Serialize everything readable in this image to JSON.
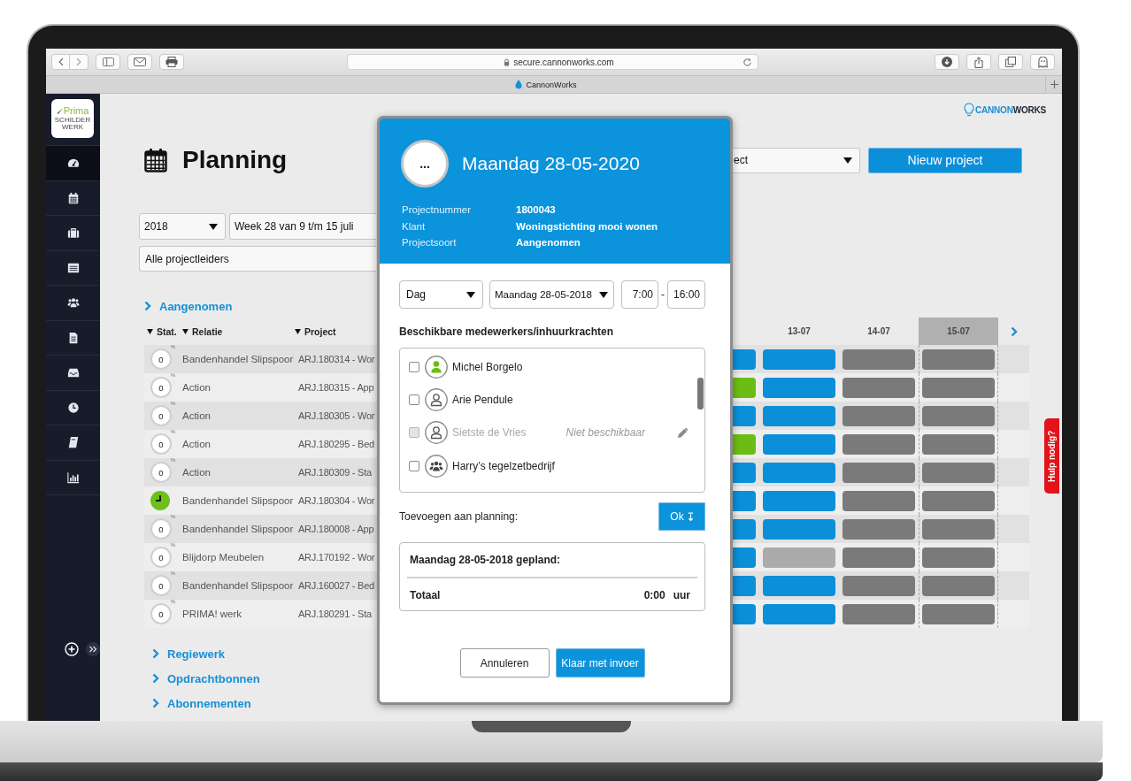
{
  "browser": {
    "url": "secure.cannonworks.com",
    "tab_title": "CannonWorks"
  },
  "sidebar": {
    "logo": {
      "name": "Prima",
      "tagline": "SCHILDERWERK"
    },
    "items": [
      {
        "kind": "dashboard",
        "selected": true
      },
      {
        "kind": "calendar",
        "selected": false
      },
      {
        "kind": "briefcase",
        "selected": false
      },
      {
        "kind": "list",
        "selected": false
      },
      {
        "kind": "team",
        "selected": false
      },
      {
        "kind": "document",
        "selected": false
      },
      {
        "kind": "inbox",
        "selected": false
      },
      {
        "kind": "clock",
        "selected": false
      },
      {
        "kind": "book",
        "selected": false
      },
      {
        "kind": "chart",
        "selected": false
      }
    ]
  },
  "brand": {
    "lead": "CANNON",
    "tail": "WORKS"
  },
  "header": {
    "title": "Planning",
    "project_select": "ect",
    "new_button": "Nieuw project"
  },
  "filters": {
    "year": "2018",
    "week": "Week 28 van 9 t/m 15 juli",
    "leader": "Alle projectleiders"
  },
  "table": {
    "section": "Aangenomen",
    "columns": [
      "Stat.",
      "Relatie",
      "Project"
    ],
    "days": [
      {
        "label": "13-07",
        "today": false
      },
      {
        "label": "14-07",
        "today": false
      },
      {
        "label": "15-07",
        "today": true
      }
    ],
    "rows": [
      {
        "status": {
          "kind": "percent",
          "value": "0",
          "unit": "%"
        },
        "relatie": "Bandenhandel Slipspoor",
        "project": "ARJ.180314 - Wor",
        "cut_bar": {
          "color": "#0b8fd9"
        },
        "bars": [
          {
            "color": "#0b8fd9"
          },
          {
            "color": "#7a7a7a"
          },
          {
            "color": "#7a7a7a"
          }
        ]
      },
      {
        "status": {
          "kind": "percent",
          "value": "0",
          "unit": "%"
        },
        "relatie": "Action",
        "project": "ARJ.180315 - App",
        "cut_bar": {
          "color": "#6cbd13"
        },
        "bars": [
          {
            "color": "#0b8fd9"
          },
          {
            "color": "#7a7a7a"
          },
          {
            "color": "#7a7a7a"
          }
        ]
      },
      {
        "status": {
          "kind": "percent",
          "value": "0",
          "unit": "%"
        },
        "relatie": "Action",
        "project": "ARJ.180305 - Wor",
        "cut_bar": {
          "color": "#0b8fd9"
        },
        "bars": [
          {
            "color": "#0b8fd9"
          },
          {
            "color": "#7a7a7a"
          },
          {
            "color": "#7a7a7a"
          }
        ]
      },
      {
        "status": {
          "kind": "percent",
          "value": "0",
          "unit": "%"
        },
        "relatie": "Action",
        "project": "ARJ.180295 - Bed",
        "cut_bar": {
          "color": "#6cbd13"
        },
        "bars": [
          {
            "color": "#0b8fd9"
          },
          {
            "color": "#7a7a7a"
          },
          {
            "color": "#7a7a7a"
          }
        ]
      },
      {
        "status": {
          "kind": "percent",
          "value": "0",
          "unit": "%"
        },
        "relatie": "Action",
        "project": "ARJ.180309 - Sta",
        "cut_bar": {
          "color": "#0b8fd9"
        },
        "bars": [
          {
            "color": "#0b8fd9"
          },
          {
            "color": "#7a7a7a"
          },
          {
            "color": "#7a7a7a"
          }
        ]
      },
      {
        "status": {
          "kind": "clock"
        },
        "relatie": "Bandenhandel Slipspoor",
        "project": "ARJ.180304 - Wor",
        "cut_bar": {
          "color": "#0b8fd9"
        },
        "bars": [
          {
            "color": "#0b8fd9"
          },
          {
            "color": "#7a7a7a"
          },
          {
            "color": "#7a7a7a"
          }
        ]
      },
      {
        "status": {
          "kind": "percent",
          "value": "0",
          "unit": "%"
        },
        "relatie": "Bandenhandel Slipspoor",
        "project": "ARJ.180008 - App",
        "cut_bar": {
          "color": "#0b8fd9"
        },
        "bars": [
          {
            "color": "#0b8fd9"
          },
          {
            "color": "#7a7a7a"
          },
          {
            "color": "#7a7a7a"
          }
        ]
      },
      {
        "status": {
          "kind": "percent",
          "value": "0",
          "unit": "%"
        },
        "relatie": "Blijdorp Meubelen",
        "project": "ARJ.170192 - Wor",
        "cut_bar": {
          "color": "#0b8fd9"
        },
        "bars": [
          {
            "color": "#ababab"
          },
          {
            "color": "#7a7a7a"
          },
          {
            "color": "#7a7a7a"
          }
        ]
      },
      {
        "status": {
          "kind": "percent",
          "value": "0",
          "unit": "%"
        },
        "relatie": "Bandenhandel Slipspoor",
        "project": "ARJ.160027 - Bed",
        "cut_bar": {
          "color": "#0b8fd9"
        },
        "bars": [
          {
            "color": "#0b8fd9"
          },
          {
            "color": "#7a7a7a"
          },
          {
            "color": "#7a7a7a"
          }
        ]
      },
      {
        "status": {
          "kind": "percent",
          "value": "0",
          "unit": "%"
        },
        "relatie": "PRIMA! werk",
        "project": "ARJ.180291 - Sta",
        "cut_bar": {
          "color": "#0b8fd9"
        },
        "bars": [
          {
            "color": "#0b8fd9"
          },
          {
            "color": "#7a7a7a"
          },
          {
            "color": "#7a7a7a"
          }
        ]
      }
    ]
  },
  "more_sections": [
    "Regiewerk",
    "Opdrachtbonnen",
    "Abonnementen"
  ],
  "help_tab": "Hulp nodig?",
  "dialog": {
    "avatar_text": "...",
    "title": "Maandag 28-05-2020",
    "details": [
      {
        "label": "Projectnummer",
        "value": "1800043"
      },
      {
        "label": "Klant",
        "value": "Woningstichting mooi wonen"
      },
      {
        "label": "Projectsoort",
        "value": "Aangenomen"
      }
    ],
    "period": "Dag",
    "date": "Maandag 28-05-2018",
    "start_time": "7:00",
    "time_separator": "-",
    "end_time": "16:00",
    "workers_title": "Beschikbare medewerkers/inhuurkrachten",
    "workers": [
      {
        "name": "Michel Borgelo",
        "kind": "person",
        "active": true,
        "checked": false,
        "disabled": false,
        "editable": false
      },
      {
        "name": "Arie Pendule",
        "kind": "person",
        "active": false,
        "checked": false,
        "disabled": false,
        "editable": false
      },
      {
        "name": "Sietste de Vries",
        "kind": "person",
        "active": false,
        "checked": false,
        "disabled": true,
        "note": "Niet beschikbaar",
        "editable": true
      },
      {
        "name": "Harry’s tegelzetbedrijf",
        "kind": "group",
        "active": false,
        "checked": false,
        "disabled": false,
        "editable": false
      }
    ],
    "add_label": "Toevoegen aan planning:",
    "add_button": "Ok",
    "summary": {
      "title": "Maandag 28-05-2018 gepland:",
      "total_label": "Totaal",
      "total": "0:00",
      "unit": "uur"
    },
    "buttons": [
      {
        "label": "Annuleren",
        "kind": "secondary"
      },
      {
        "label": "Klaar met invoer",
        "kind": "primary"
      }
    ]
  }
}
